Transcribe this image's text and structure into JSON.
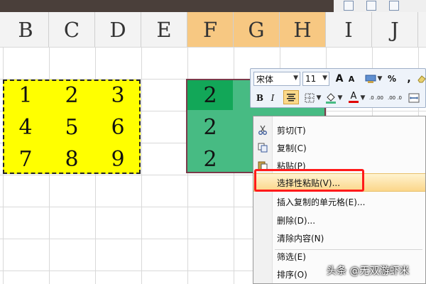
{
  "columns": [
    "B",
    "C",
    "D",
    "E",
    "F",
    "G",
    "H",
    "I",
    "J"
  ],
  "selected_columns": [
    "F",
    "G",
    "H"
  ],
  "copied_values": [
    [
      "1",
      "2",
      "3"
    ],
    [
      "4",
      "5",
      "6"
    ],
    [
      "7",
      "8",
      "9"
    ]
  ],
  "target_values": [
    "2",
    "2",
    "2"
  ],
  "mini_toolbar": {
    "font_name": "宋体",
    "font_size": "11",
    "grow_font": "A",
    "shrink_font": "A",
    "percent": "%",
    "comma": ",",
    "bold": "B",
    "italic": "I",
    "font_color_letter": "A",
    "inc_decimal": ".0 .00",
    "dec_decimal": ".00 .0"
  },
  "context_menu": {
    "items": [
      {
        "label": "剪切(T)",
        "icon": "scissors-icon"
      },
      {
        "label": "复制(C)",
        "icon": "copy-icon"
      },
      {
        "label": "粘贴(P)",
        "icon": "paste-icon"
      },
      {
        "label": "选择性粘贴(V)...",
        "icon": ""
      },
      {
        "label": "插入复制的单元格(E)...",
        "icon": ""
      },
      {
        "label": "删除(D)...",
        "icon": ""
      },
      {
        "label": "清除内容(N)",
        "icon": ""
      },
      {
        "label": "筛选(E)",
        "icon": ""
      },
      {
        "label": "排序(O)",
        "icon": ""
      }
    ],
    "highlighted_index": 3
  },
  "watermark": "头条 @无双游虾米",
  "colors": {
    "copied_fill": "#ffff00",
    "target_fill": "#47bb83",
    "active_cell": "#12a758",
    "selected_header": "#f7c882",
    "highlight_border": "#ff1a1a"
  }
}
